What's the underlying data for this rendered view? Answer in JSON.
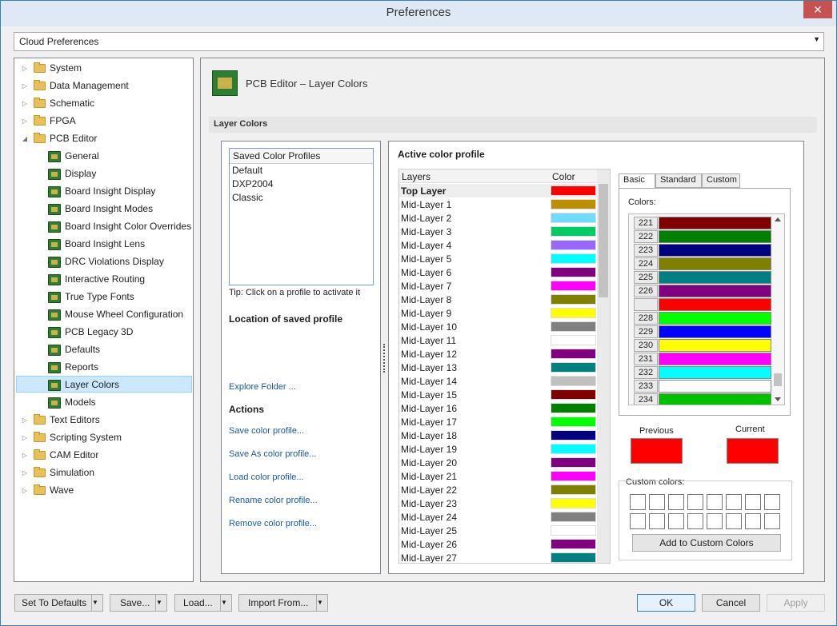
{
  "window": {
    "title": "Preferences",
    "close_glyph": "✕"
  },
  "combo": {
    "value": "Cloud Preferences",
    "arrow": "▼"
  },
  "tree": {
    "expander_collapsed": "▷",
    "expander_expanded": "◢",
    "items": [
      {
        "label": "System",
        "type": "folder"
      },
      {
        "label": "Data Management",
        "type": "folder"
      },
      {
        "label": "Schematic",
        "type": "folder"
      },
      {
        "label": "FPGA",
        "type": "folder"
      },
      {
        "label": "PCB Editor",
        "type": "folder-open"
      },
      {
        "label": "General",
        "type": "page"
      },
      {
        "label": "Display",
        "type": "page"
      },
      {
        "label": "Board Insight Display",
        "type": "page"
      },
      {
        "label": "Board Insight Modes",
        "type": "page"
      },
      {
        "label": "Board Insight Color Overrides",
        "type": "page"
      },
      {
        "label": "Board Insight Lens",
        "type": "page"
      },
      {
        "label": "DRC Violations Display",
        "type": "page"
      },
      {
        "label": "Interactive Routing",
        "type": "page"
      },
      {
        "label": "True Type Fonts",
        "type": "page"
      },
      {
        "label": "Mouse Wheel Configuration",
        "type": "page"
      },
      {
        "label": "PCB Legacy 3D",
        "type": "page"
      },
      {
        "label": "Defaults",
        "type": "page"
      },
      {
        "label": "Reports",
        "type": "page"
      },
      {
        "label": "Layer Colors",
        "type": "page",
        "selected": true
      },
      {
        "label": "Models",
        "type": "page"
      },
      {
        "label": "Text Editors",
        "type": "folder"
      },
      {
        "label": "Scripting System",
        "type": "folder"
      },
      {
        "label": "CAM Editor",
        "type": "folder"
      },
      {
        "label": "Simulation",
        "type": "folder"
      },
      {
        "label": "Wave",
        "type": "folder"
      }
    ]
  },
  "panel": {
    "title": "PCB Editor – Layer Colors",
    "section": "Layer Colors",
    "profiles_header": "Saved Color Profiles",
    "profiles": [
      "Default",
      "DXP2004",
      "Classic"
    ],
    "tip": "Tip: Click on a profile to activate it",
    "location_label": "Location of saved profile",
    "explore": "Explore Folder ...",
    "actions_label": "Actions",
    "actions": [
      "Save color profile...",
      "Save As color profile...",
      "Load color profile...",
      "Rename color profile...",
      "Remove color profile..."
    ],
    "active_label": "Active color profile",
    "layers_header": "Layers",
    "color_header": "Color",
    "layers": [
      {
        "name": "Top Layer",
        "color": "#ff0000",
        "bold": true
      },
      {
        "name": "Mid-Layer 1",
        "color": "#bc8e00"
      },
      {
        "name": "Mid-Layer 2",
        "color": "#70dbfa"
      },
      {
        "name": "Mid-Layer 3",
        "color": "#00cc66"
      },
      {
        "name": "Mid-Layer 4",
        "color": "#9966ff"
      },
      {
        "name": "Mid-Layer 5",
        "color": "#00ffff"
      },
      {
        "name": "Mid-Layer 6",
        "color": "#800080"
      },
      {
        "name": "Mid-Layer 7",
        "color": "#ff00ff"
      },
      {
        "name": "Mid-Layer 8",
        "color": "#808000"
      },
      {
        "name": "Mid-Layer 9",
        "color": "#ffff00"
      },
      {
        "name": "Mid-Layer 10",
        "color": "#808080"
      },
      {
        "name": "Mid-Layer 11",
        "color": "#ffffff"
      },
      {
        "name": "Mid-Layer 12",
        "color": "#800080"
      },
      {
        "name": "Mid-Layer 13",
        "color": "#008080"
      },
      {
        "name": "Mid-Layer 14",
        "color": "#c0c0c0"
      },
      {
        "name": "Mid-Layer 15",
        "color": "#800000"
      },
      {
        "name": "Mid-Layer 16",
        "color": "#008000"
      },
      {
        "name": "Mid-Layer 17",
        "color": "#00ff00"
      },
      {
        "name": "Mid-Layer 18",
        "color": "#000080"
      },
      {
        "name": "Mid-Layer 19",
        "color": "#00ffff"
      },
      {
        "name": "Mid-Layer 20",
        "color": "#800080"
      },
      {
        "name": "Mid-Layer 21",
        "color": "#ff00ff"
      },
      {
        "name": "Mid-Layer 22",
        "color": "#808000"
      },
      {
        "name": "Mid-Layer 23",
        "color": "#ffff00"
      },
      {
        "name": "Mid-Layer 24",
        "color": "#808080"
      },
      {
        "name": "Mid-Layer 25",
        "color": "#ffffff"
      },
      {
        "name": "Mid-Layer 26",
        "color": "#800080"
      },
      {
        "name": "Mid-Layer 27",
        "color": "#008080"
      }
    ],
    "tabs": [
      "Basic",
      "Standard",
      "Custom"
    ],
    "colors_label": "Colors:",
    "color_rows": [
      {
        "num": "221",
        "color": "#800000"
      },
      {
        "num": "222",
        "color": "#008000"
      },
      {
        "num": "223",
        "color": "#000080"
      },
      {
        "num": "224",
        "color": "#808000"
      },
      {
        "num": "225",
        "color": "#008080"
      },
      {
        "num": "226",
        "color": "#800080"
      },
      {
        "num": "",
        "color": "#ff0000"
      },
      {
        "num": "228",
        "color": "#00ff00"
      },
      {
        "num": "229",
        "color": "#0000ff"
      },
      {
        "num": "230",
        "color": "#ffff00"
      },
      {
        "num": "231",
        "color": "#ff00ff"
      },
      {
        "num": "232",
        "color": "#00ffff"
      },
      {
        "num": "233",
        "color": "#ffffff"
      },
      {
        "num": "234",
        "color": "#00c000"
      }
    ],
    "previous_label": "Previous",
    "current_label": "Current",
    "previous_color": "#ff0000",
    "current_color": "#ff0000",
    "custom_label": "Custom colors:",
    "add_custom": "Add to Custom Colors"
  },
  "buttons": {
    "set_defaults": "Set To Defaults",
    "save": "Save...",
    "load": "Load...",
    "import": "Import From...",
    "ok": "OK",
    "cancel": "Cancel",
    "apply": "Apply",
    "dropdown_glyph": "▼"
  }
}
